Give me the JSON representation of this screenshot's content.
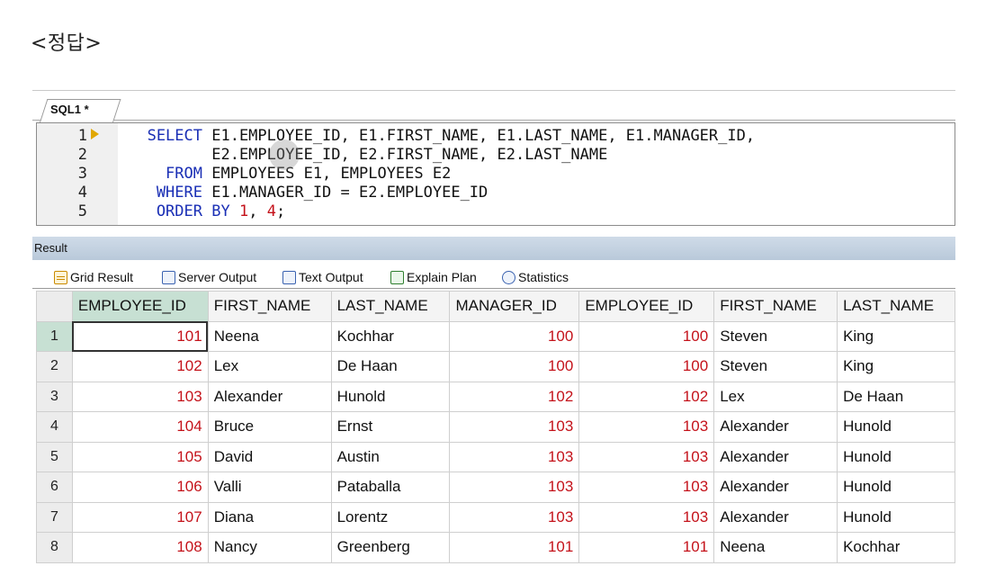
{
  "heading": "<정답>",
  "editor": {
    "tab_label": "SQL1 *",
    "line_numbers": [
      "1",
      "2",
      "3",
      "4",
      "5"
    ],
    "lines": [
      {
        "kw": "SELECT",
        "text": " E1.EMPLOYEE_ID, E1.FIRST_NAME, E1.LAST_NAME, E1.MANAGER_ID,"
      },
      {
        "kw": "",
        "text": " E2.EMPLOYEE_ID, E2.FIRST_NAME, E2.LAST_NAME"
      },
      {
        "kw": "FROM",
        "text": " EMPLOYEES E1, EMPLOYEES E2"
      },
      {
        "kw": "WHERE",
        "text": " E1.MANAGER_ID = E2.EMPLOYEE_ID"
      },
      {
        "kw": "ORDER",
        "text_kw": " BY ",
        "n1": "1",
        "sep": ", ",
        "n2": "4",
        "end": ";"
      }
    ]
  },
  "result": {
    "label": "Result",
    "tabs": [
      {
        "label": "Grid Result",
        "icon": "grid-icon"
      },
      {
        "label": "Server Output",
        "icon": "server-output-icon"
      },
      {
        "label": "Text Output",
        "icon": "text-output-icon"
      },
      {
        "label": "Explain Plan",
        "icon": "explain-plan-icon"
      },
      {
        "label": "Statistics",
        "icon": "statistics-icon"
      }
    ],
    "columns": [
      "EMPLOYEE_ID",
      "FIRST_NAME",
      "LAST_NAME",
      "MANAGER_ID",
      "EMPLOYEE_ID",
      "FIRST_NAME",
      "LAST_NAME"
    ],
    "rows": [
      [
        "1",
        "101",
        "Neena",
        "Kochhar",
        "100",
        "100",
        "Steven",
        "King"
      ],
      [
        "2",
        "102",
        "Lex",
        "De  Haan",
        "100",
        "100",
        "Steven",
        "King"
      ],
      [
        "3",
        "103",
        "Alexander",
        "Hunold",
        "102",
        "102",
        "Lex",
        "De  Haan"
      ],
      [
        "4",
        "104",
        "Bruce",
        "Ernst",
        "103",
        "103",
        "Alexander",
        "Hunold"
      ],
      [
        "5",
        "105",
        "David",
        "Austin",
        "103",
        "103",
        "Alexander",
        "Hunold"
      ],
      [
        "6",
        "106",
        "Valli",
        "Pataballa",
        "103",
        "103",
        "Alexander",
        "Hunold"
      ],
      [
        "7",
        "107",
        "Diana",
        "Lorentz",
        "103",
        "103",
        "Alexander",
        "Hunold"
      ],
      [
        "8",
        "108",
        "Nancy",
        "Greenberg",
        "101",
        "101",
        "Neena",
        "Kochhar"
      ]
    ]
  },
  "colors": {
    "keyword": "#1a2fb5",
    "number_literal": "#c4121a",
    "selected_header": "#c7e0d3",
    "result_header": "#b9c9da"
  }
}
